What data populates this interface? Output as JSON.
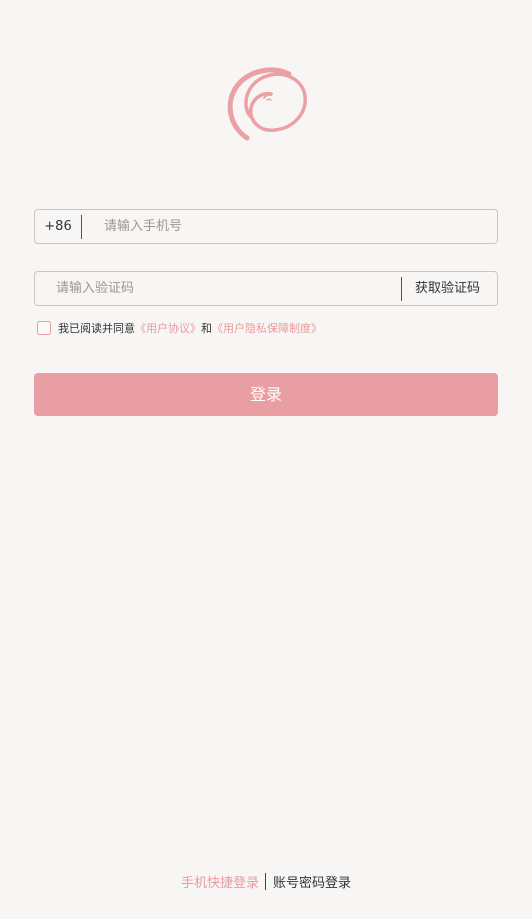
{
  "phone": {
    "country_code": "+86",
    "placeholder": "请输入手机号",
    "value": ""
  },
  "verification": {
    "placeholder": "请输入验证码",
    "value": "",
    "get_code_label": "获取验证码"
  },
  "agreement": {
    "checked": false,
    "prefix": "我已阅读并同意",
    "user_agreement": "《用户协议》",
    "conjunction": "和",
    "privacy_policy": "《用户隐私保障制度》"
  },
  "login_button_label": "登录",
  "login_methods": {
    "active": "手机快捷登录",
    "other": "账号密码登录"
  },
  "colors": {
    "accent": "#e89aa0",
    "button": "#e99ea3",
    "background": "#f8f6f4"
  },
  "icons": {
    "logo": "swirl-logo-icon"
  }
}
